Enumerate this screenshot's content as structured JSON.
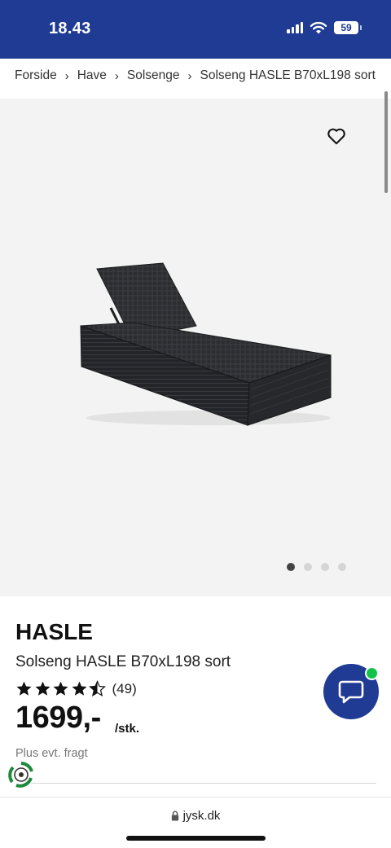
{
  "status_bar": {
    "time": "18.43",
    "battery_level": "59",
    "signal_bars": 4,
    "background_color": "#1f3b93"
  },
  "breadcrumb": {
    "items": [
      "Forside",
      "Have",
      "Solsenge",
      "Solseng HASLE B70xL198 sort"
    ],
    "separator_icon": "chevron-right-icon"
  },
  "gallery": {
    "image_alt_subject": "sun lounger",
    "wishlist_icon": "heart-outline-icon",
    "image_count": 4,
    "active_image_index": 0
  },
  "product": {
    "brand": "HASLE",
    "name": "Solseng HASLE B70xL198 sort",
    "rating_value": 4.5,
    "rating_max": 5,
    "review_count": "(49)",
    "price": "1699,-",
    "unit": "/stk.",
    "shipping_note": "Plus evt. fragt"
  },
  "chat": {
    "icon": "chat-bubble-icon",
    "status": "online",
    "status_color": "#13c24a"
  },
  "browser": {
    "url": "jysk.dk",
    "secure_icon": "lock-icon"
  },
  "badge": {
    "icon": "eco-recycle-icon"
  }
}
